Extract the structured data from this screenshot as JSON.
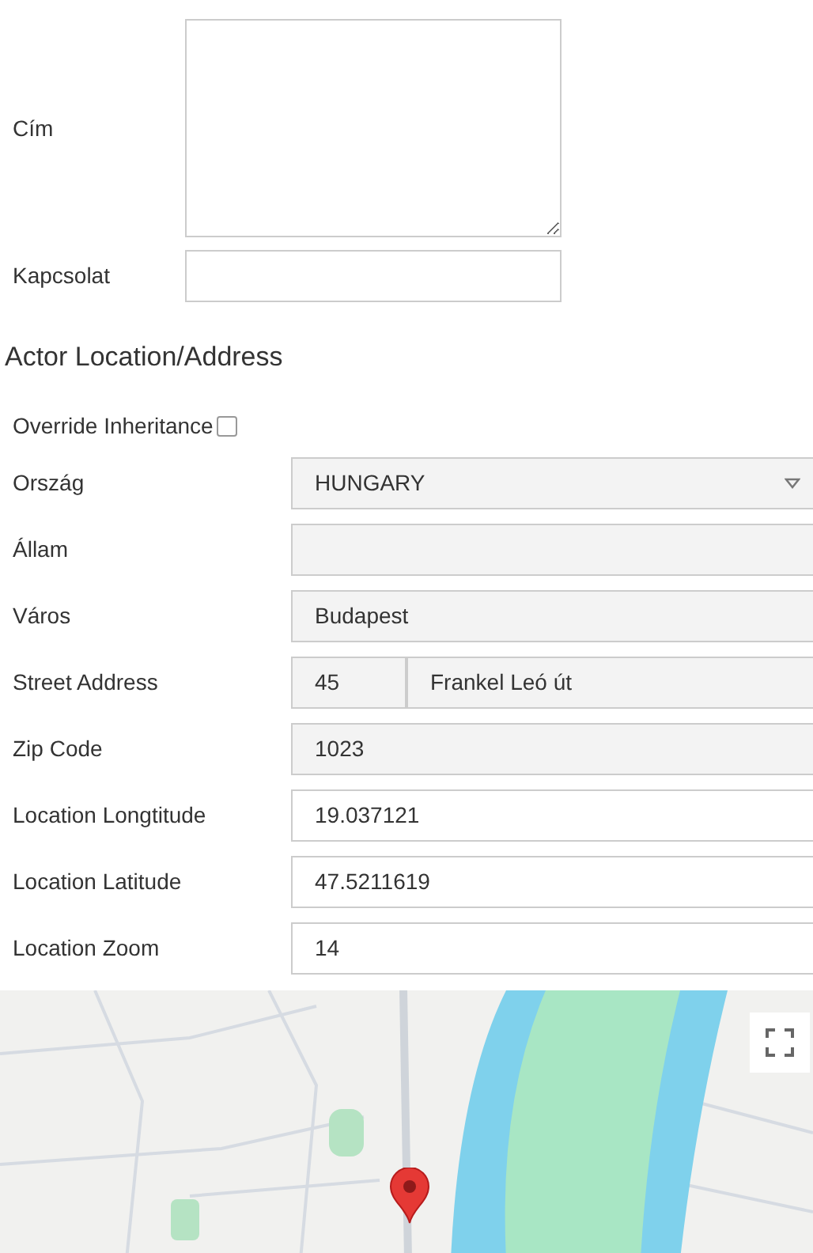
{
  "contact_fields": [
    {
      "label": "Cím",
      "kind": "textarea"
    },
    {
      "label": "Kapcsolat",
      "kind": "text"
    }
  ],
  "section_title": "Actor Location/Address",
  "override_inheritance": {
    "label": "Override Inheritance",
    "checked": false
  },
  "location_fields": [
    {
      "label": "Ország",
      "kind": "select",
      "value": "HUNGARY",
      "disabled": true
    },
    {
      "label": "Állam",
      "kind": "text",
      "disabled": true
    },
    {
      "label": "Város",
      "kind": "text",
      "value": "Budapest",
      "disabled": true
    },
    {
      "label": "Street Address",
      "kind": "split",
      "values": [
        "45",
        "Frankel Leó út"
      ],
      "disabled": true
    },
    {
      "label": "Zip Code",
      "kind": "text",
      "value": "1023",
      "disabled": true
    },
    {
      "label": "Location Longtitude",
      "kind": "text",
      "value": "19.037121",
      "disabled": false
    },
    {
      "label": "Location Latitude",
      "kind": "text",
      "value": "47.5211619",
      "disabled": false
    },
    {
      "label": "Location Zoom",
      "kind": "text",
      "value": "14",
      "disabled": false
    }
  ]
}
